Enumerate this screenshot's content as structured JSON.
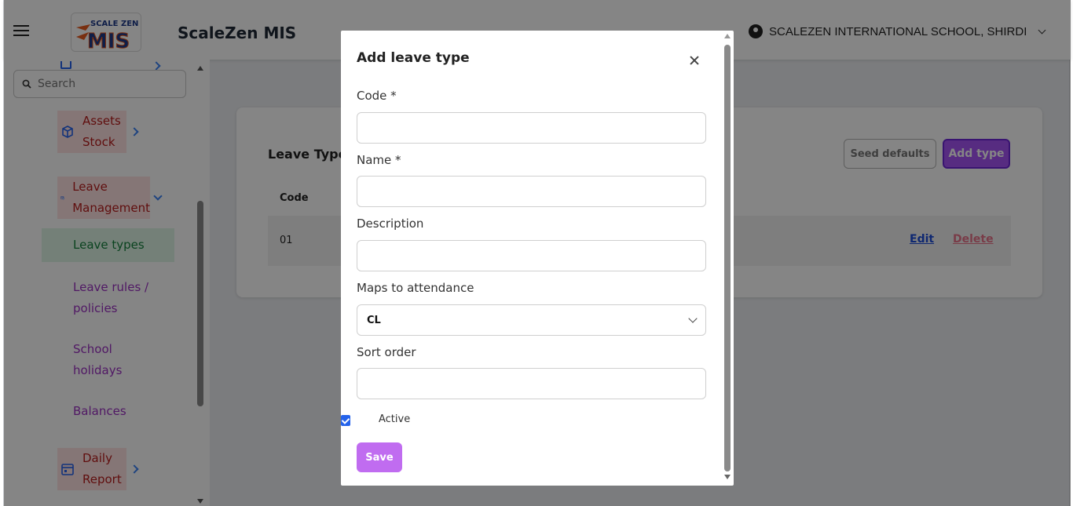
{
  "header": {
    "app_title": "ScaleZen MIS",
    "logo_text_top": "SCALE ZEN",
    "logo_text_main": "MIS",
    "school_name": "SCALEZEN INTERNATIONAL SCHOOL, SHIRDI"
  },
  "sidebar": {
    "search_placeholder": "Search",
    "items": [
      {
        "label_line1": "Assets",
        "label_line2": "Stock"
      },
      {
        "label_line1": "Leave",
        "label_line2": "Management"
      },
      {
        "label_line1": "Daily",
        "label_line2": "Report"
      }
    ],
    "subitems": [
      {
        "label": "Leave types"
      },
      {
        "label_line1": "Leave rules /",
        "label_line2": "policies"
      },
      {
        "label_line1": "School",
        "label_line2": "holidays"
      },
      {
        "label": "Balances"
      }
    ]
  },
  "main": {
    "title": "Leave Types",
    "seed_button": "Seed defaults",
    "add_button": "Add type",
    "column_code": "Code",
    "rows": [
      {
        "code": "01",
        "edit": "Edit",
        "delete": "Delete"
      }
    ]
  },
  "modal": {
    "title": "Add leave type",
    "fields": {
      "code_label": "Code *",
      "code_value": "",
      "name_label": "Name *",
      "name_value": "",
      "description_label": "Description",
      "description_value": "",
      "maps_label": "Maps to attendance",
      "maps_value": "CL",
      "sort_label": "Sort order",
      "sort_value": ""
    },
    "active_label": "Active",
    "active_checked": true,
    "save_button": "Save"
  },
  "colors": {
    "accent": "#a855f7",
    "nav_text": "#b91c1c",
    "sub_text": "#9b30c2",
    "active_sub": "#15803d",
    "link": "#1d4ed8",
    "danger": "#e8748a"
  }
}
